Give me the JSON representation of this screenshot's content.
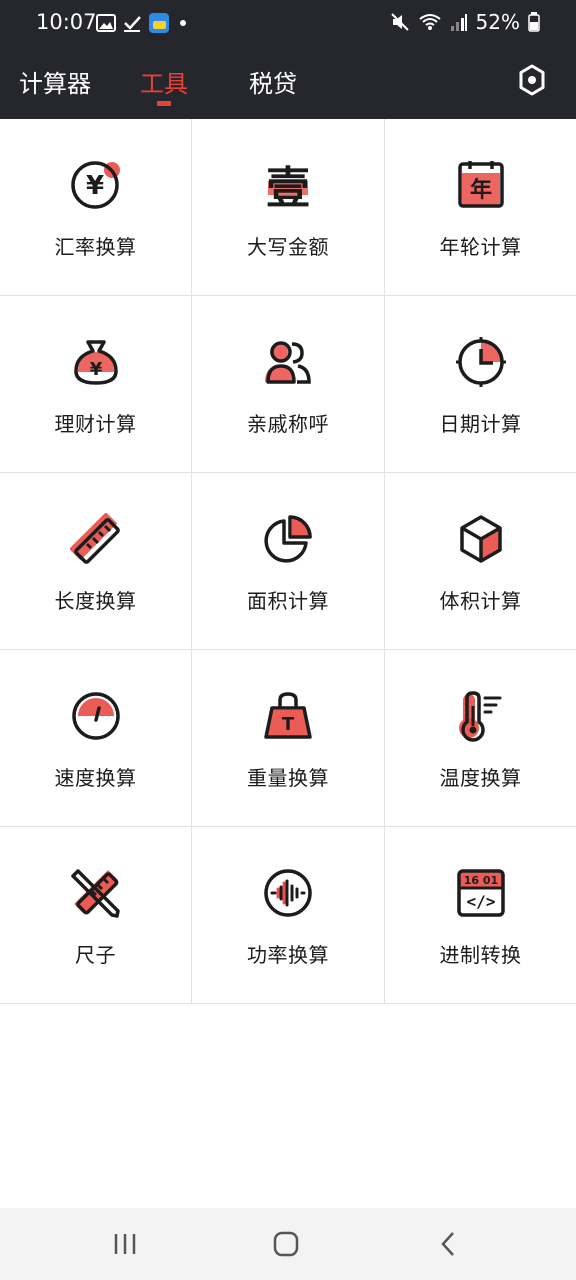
{
  "status_bar": {
    "time": "10:07",
    "battery": "52%"
  },
  "nav": {
    "tabs": [
      {
        "label": "计算器"
      },
      {
        "label": "工具"
      },
      {
        "label": "税贷"
      }
    ],
    "active_tab": "工具"
  },
  "tools": [
    {
      "label": "汇率换算",
      "icon": "currency-icon"
    },
    {
      "label": "大写金额",
      "icon": "uppercase-amount-icon"
    },
    {
      "label": "年轮计算",
      "icon": "year-calendar-icon"
    },
    {
      "label": "理财计算",
      "icon": "money-bag-icon"
    },
    {
      "label": "亲戚称呼",
      "icon": "relatives-icon"
    },
    {
      "label": "日期计算",
      "icon": "clock-icon"
    },
    {
      "label": "长度换算",
      "icon": "ruler-icon"
    },
    {
      "label": "面积计算",
      "icon": "pie-area-icon"
    },
    {
      "label": "体积计算",
      "icon": "cube-icon"
    },
    {
      "label": "速度换算",
      "icon": "speedometer-icon"
    },
    {
      "label": "重量换算",
      "icon": "weight-icon"
    },
    {
      "label": "温度换算",
      "icon": "thermometer-icon"
    },
    {
      "label": "尺子",
      "icon": "ruler-pencil-icon"
    },
    {
      "label": "功率换算",
      "icon": "waveform-icon"
    },
    {
      "label": "进制转换",
      "icon": "code-calendar-icon"
    }
  ],
  "icon_glyphs": {
    "currency": "¥",
    "uppercase": "壹",
    "year": "年",
    "weight": "T",
    "code_top": "16 01",
    "code_bottom": "</>"
  },
  "colors": {
    "bar_bg": "#26272d",
    "accent": "#e9403a",
    "text": "#1c1c1c",
    "divider": "#e2e2e2"
  }
}
